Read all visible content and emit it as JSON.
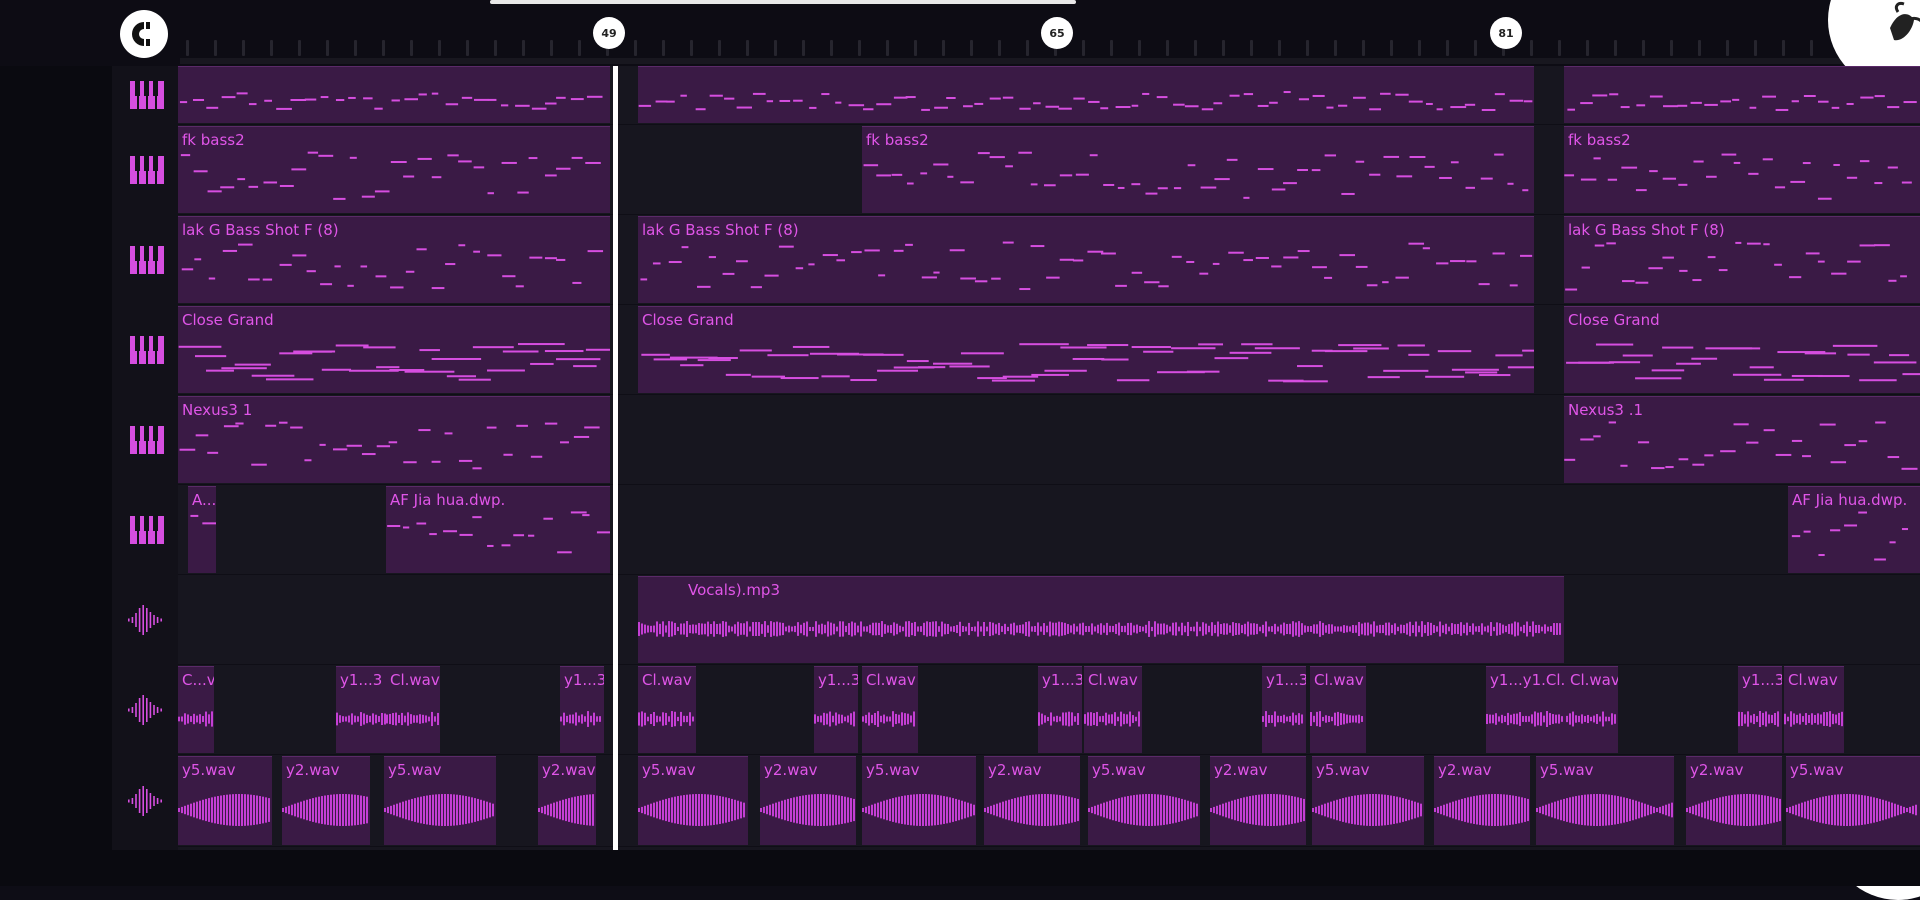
{
  "timeline": {
    "markers": [
      "49",
      "65",
      "81"
    ]
  },
  "icons": {
    "logo": "magnet-snap-icon",
    "corner_top": "fl-studio-fruit-icon",
    "corner_mid": "chevron-left-icon",
    "corner_bottom": "arrow-up-left-icon",
    "piano": "piano-roll-icon",
    "audio": "waveform-icon"
  },
  "colors": {
    "accent": "#e055e8",
    "clip_bg": "#3a1a45",
    "background": "#17161f"
  },
  "tracks": [
    {
      "type": "piano",
      "clips": [
        {
          "name": ""
        },
        {
          "name": ""
        },
        {
          "name": ""
        }
      ]
    },
    {
      "type": "piano",
      "clips": [
        {
          "name": "fk bass2"
        },
        {
          "name": "fk bass2"
        },
        {
          "name": "fk bass2"
        }
      ]
    },
    {
      "type": "piano",
      "clips": [
        {
          "name": "lak   G Bass Shot F (8)"
        },
        {
          "name": "lak   G Bass Shot F (8)"
        },
        {
          "name": "lak   G Bass Shot F (8)"
        }
      ]
    },
    {
      "type": "piano",
      "clips": [
        {
          "name": "Close Grand"
        },
        {
          "name": "Close Grand"
        },
        {
          "name": "Close Grand"
        }
      ]
    },
    {
      "type": "piano",
      "clips": [
        {
          "name": "Nexus3  1"
        },
        {
          "name": "Nexus3 .1"
        }
      ]
    },
    {
      "type": "piano",
      "clips": [
        {
          "name": "A..."
        },
        {
          "name": "AF Jia hua.dwp."
        },
        {
          "name": "AF Jia hua.dwp."
        }
      ]
    },
    {
      "type": "audio",
      "clips": [
        {
          "name": "Vocals).mp3"
        }
      ]
    },
    {
      "type": "audio",
      "clips": [
        {
          "name": "C...v"
        },
        {
          "name": "y1...3"
        },
        {
          "name": "Cl.wav"
        },
        {
          "name": "y1...3"
        },
        {
          "name": "Cl.wav"
        },
        {
          "name": "y1...3"
        },
        {
          "name": "Cl.wav"
        },
        {
          "name": "y1...3"
        },
        {
          "name": "Cl.wav"
        },
        {
          "name": "y1...3"
        },
        {
          "name": "Cl.wav"
        },
        {
          "name": "y1...y1.Cl.wav"
        },
        {
          "name": "Cl.wav"
        },
        {
          "name": "y1...3"
        },
        {
          "name": "Cl.wav"
        }
      ]
    },
    {
      "type": "audio",
      "clips": [
        {
          "name": "y5.wav"
        },
        {
          "name": "y2.wav"
        },
        {
          "name": "y5.wav"
        },
        {
          "name": "y2.wav"
        },
        {
          "name": "y5.wav"
        },
        {
          "name": "y2.wav"
        },
        {
          "name": "y5.wav"
        },
        {
          "name": "y2.wav"
        },
        {
          "name": "y5.wav"
        },
        {
          "name": "y2.wav"
        },
        {
          "name": "y5.wav"
        },
        {
          "name": "y2.wav"
        },
        {
          "name": "y5.wav"
        },
        {
          "name": "y2.wav"
        },
        {
          "name": "y5.wav"
        }
      ]
    }
  ]
}
